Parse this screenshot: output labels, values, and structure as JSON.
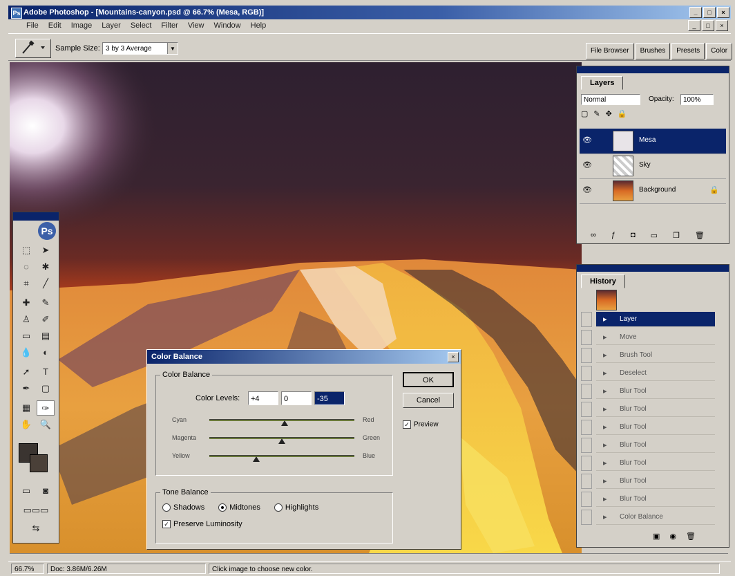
{
  "window": {
    "title": "Adobe Photoshop - [Mountains-canyon.psd @ 66.7% (Mesa, RGB)]",
    "minimize_label": "_",
    "maximize_label": "□",
    "close_label": "×"
  },
  "menubar": {
    "items": [
      "File",
      "Edit",
      "Image",
      "Layer",
      "Select",
      "Filter",
      "View",
      "Window",
      "Help"
    ]
  },
  "options_bar": {
    "sample_size_label": "Sample Size:",
    "sample_size_value": "3 by 3 Average",
    "palette_well_tabs": [
      "File Browser",
      "Brushes",
      "Presets",
      "Color"
    ]
  },
  "toolbox": {
    "logo": "Ps"
  },
  "layers_palette": {
    "title": "Layers",
    "blend_mode": "Normal",
    "opacity_label": "Opacity:",
    "opacity_value": "100%",
    "layers": [
      {
        "name": "Mesa",
        "selected": true
      },
      {
        "name": "Sky",
        "selected": false
      },
      {
        "name": "Background",
        "selected": false
      }
    ]
  },
  "history_palette": {
    "title": "History",
    "items": [
      {
        "label": "Layer",
        "selected": true
      },
      {
        "label": "Move",
        "selected": false
      },
      {
        "label": "Brush Tool",
        "selected": false
      },
      {
        "label": "Deselect",
        "selected": false
      },
      {
        "label": "Blur Tool",
        "selected": false
      },
      {
        "label": "Blur Tool",
        "selected": false
      },
      {
        "label": "Blur Tool",
        "selected": false
      },
      {
        "label": "Blur Tool",
        "selected": false
      },
      {
        "label": "Blur Tool",
        "selected": false
      },
      {
        "label": "Blur Tool",
        "selected": false
      },
      {
        "label": "Blur Tool",
        "selected": false
      },
      {
        "label": "Color Balance",
        "selected": false
      }
    ]
  },
  "color_balance_dialog": {
    "title": "Color Balance",
    "group_label": "Color Balance",
    "color_levels_label": "Color Levels:",
    "levels": [
      "+4",
      "0",
      "-35"
    ],
    "sliders": [
      {
        "left": "Cyan",
        "right": "Red",
        "value": 4
      },
      {
        "left": "Magenta",
        "right": "Green",
        "value": 0
      },
      {
        "left": "Yellow",
        "right": "Blue",
        "value": -35
      }
    ],
    "ok_label": "OK",
    "cancel_label": "Cancel",
    "preview_label": "Preview",
    "tone_group_label": "Tone Balance",
    "tones": [
      "Shadows",
      "Midtones",
      "Highlights"
    ],
    "selected_tone": "Midtones",
    "preserve_label": "Preserve Luminosity"
  },
  "status_bar": {
    "zoom": "66.7%",
    "doc_size": "Doc: 3.86M/6.26M",
    "hint": "Click image to choose new color."
  },
  "colors": {
    "titlebar_start": "#0a246a",
    "titlebar_end": "#a6caf0",
    "chrome": "#d4d0c8",
    "selection": "#0a246a"
  }
}
